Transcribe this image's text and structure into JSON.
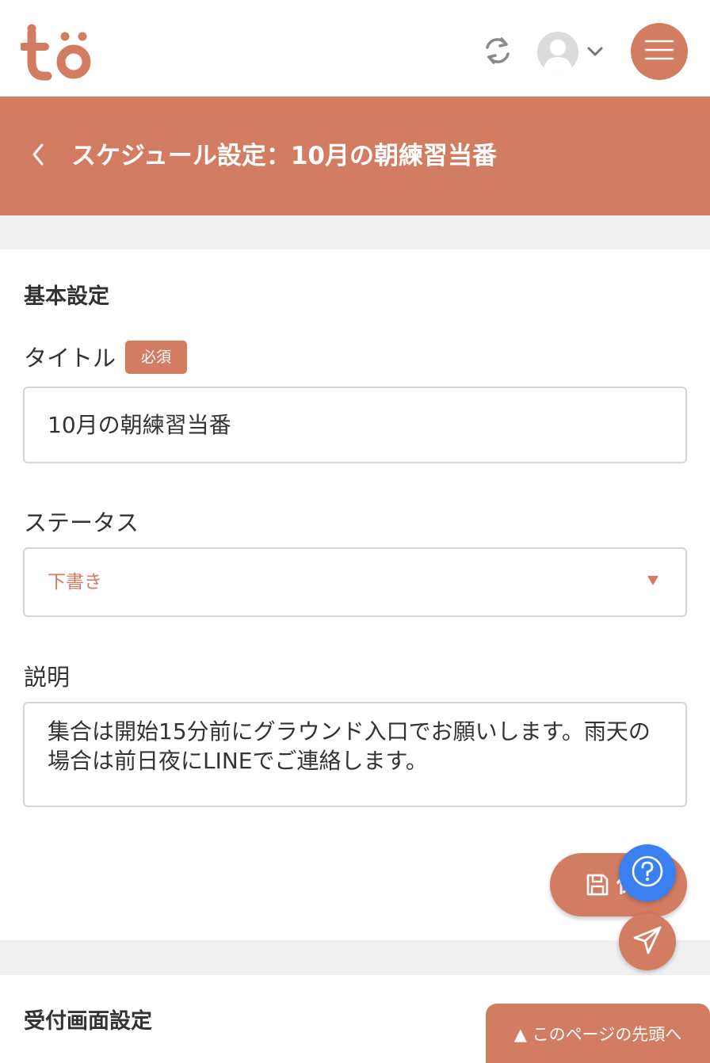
{
  "theme": {
    "accent": "#d27c61",
    "help_button": "#3a80f0",
    "page_background": "#f0f0f0",
    "text": "#333333"
  },
  "header": {
    "logo_text": "tö",
    "logo_icon": "to-logo",
    "sync_icon": "sync-icon",
    "avatar_icon": "user-avatar-icon",
    "account_menu_icon": "chevron-down-icon",
    "menu_icon": "hamburger-menu-icon"
  },
  "page": {
    "back_icon": "chevron-left-icon",
    "title": "スケジュール設定：10月の朝練習当番"
  },
  "basic_settings": {
    "heading": "基本設定",
    "title_field": {
      "label": "タイトル",
      "badge": "必須",
      "value": "10月の朝練習当番"
    },
    "status_field": {
      "label": "ステータス",
      "selected": "下書き",
      "arrow_icon": "triangle-down-icon"
    },
    "description_field": {
      "label": "説明",
      "value": "集合は開始15分前にグラウンド入口でお願いします。雨天の場合は前日夜にLINEでご連絡します。"
    }
  },
  "floating": {
    "save_label": "保",
    "save_icon": "floppy-disk-icon",
    "help_icon": "question-circle-icon",
    "send_icon": "paper-plane-icon"
  },
  "reception_settings": {
    "heading": "受付画面設定"
  },
  "to_top": {
    "label": "▲ このページの先頭へ"
  }
}
